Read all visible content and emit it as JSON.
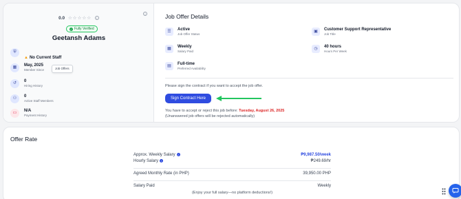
{
  "profile": {
    "rating": "0.0",
    "stars": "☆☆☆☆☆",
    "verified_label": "Fully Verified",
    "name": "Geetansh Adams",
    "stats": [
      {
        "icon": "shield-icon",
        "value": "No Current Staff",
        "label": ""
      },
      {
        "icon": "calendar-icon",
        "value": "May, 2025",
        "label": "Member Since"
      },
      {
        "icon": "history-icon",
        "value": "0",
        "label": "Hiring History"
      },
      {
        "icon": "staff-icon",
        "value": "0",
        "label": "Active Staff Members"
      },
      {
        "icon": "payment-icon",
        "value": "N/A",
        "label": "Payment History"
      }
    ],
    "tooltip": "Job Offers"
  },
  "job_offer": {
    "title": "Job Offer Details",
    "details": [
      {
        "icon": "status-icon",
        "value": "Active",
        "label": "Job Offer Status"
      },
      {
        "icon": "briefcase-icon",
        "value": "Customer Support Representative",
        "label": "Job Title"
      },
      {
        "icon": "calendar-icon",
        "value": "Weekly",
        "label": "Salary Paid"
      },
      {
        "icon": "clock-icon",
        "value": "40 hours",
        "label": "Hours Per Week"
      },
      {
        "icon": "availability-icon",
        "value": "Full-time",
        "label": "Preferred Availability"
      }
    ],
    "sign_message": "Please sign the contract if you want to accept the job offer.",
    "sign_button": "Sign Contract Here",
    "deadline_prefix": "You have to accept or reject this job before:",
    "deadline_date": "Tuesday, August 26, 2025",
    "deadline_note": "(Unanswered job offers will be rejected automatically)"
  },
  "offer_rate": {
    "title": "Offer Rate",
    "weekly_label": "Approx. Weekly Salary",
    "weekly_value": "₱9,987.50/week",
    "hourly_label": "Hourly Salary",
    "hourly_value": "₱249.69/hr",
    "monthly_label": "Agreed Monthly Rate (in PHP)",
    "monthly_value": "39,950.00 PHP",
    "paid_label": "Salary Paid",
    "paid_value": "Weekly",
    "note": "(Enjoy your full salary—no platform deductions!)"
  },
  "colors": {
    "accent": "#2f4ce0",
    "success": "#16a34a",
    "danger": "#dc2626",
    "arrow": "#22c55e"
  }
}
